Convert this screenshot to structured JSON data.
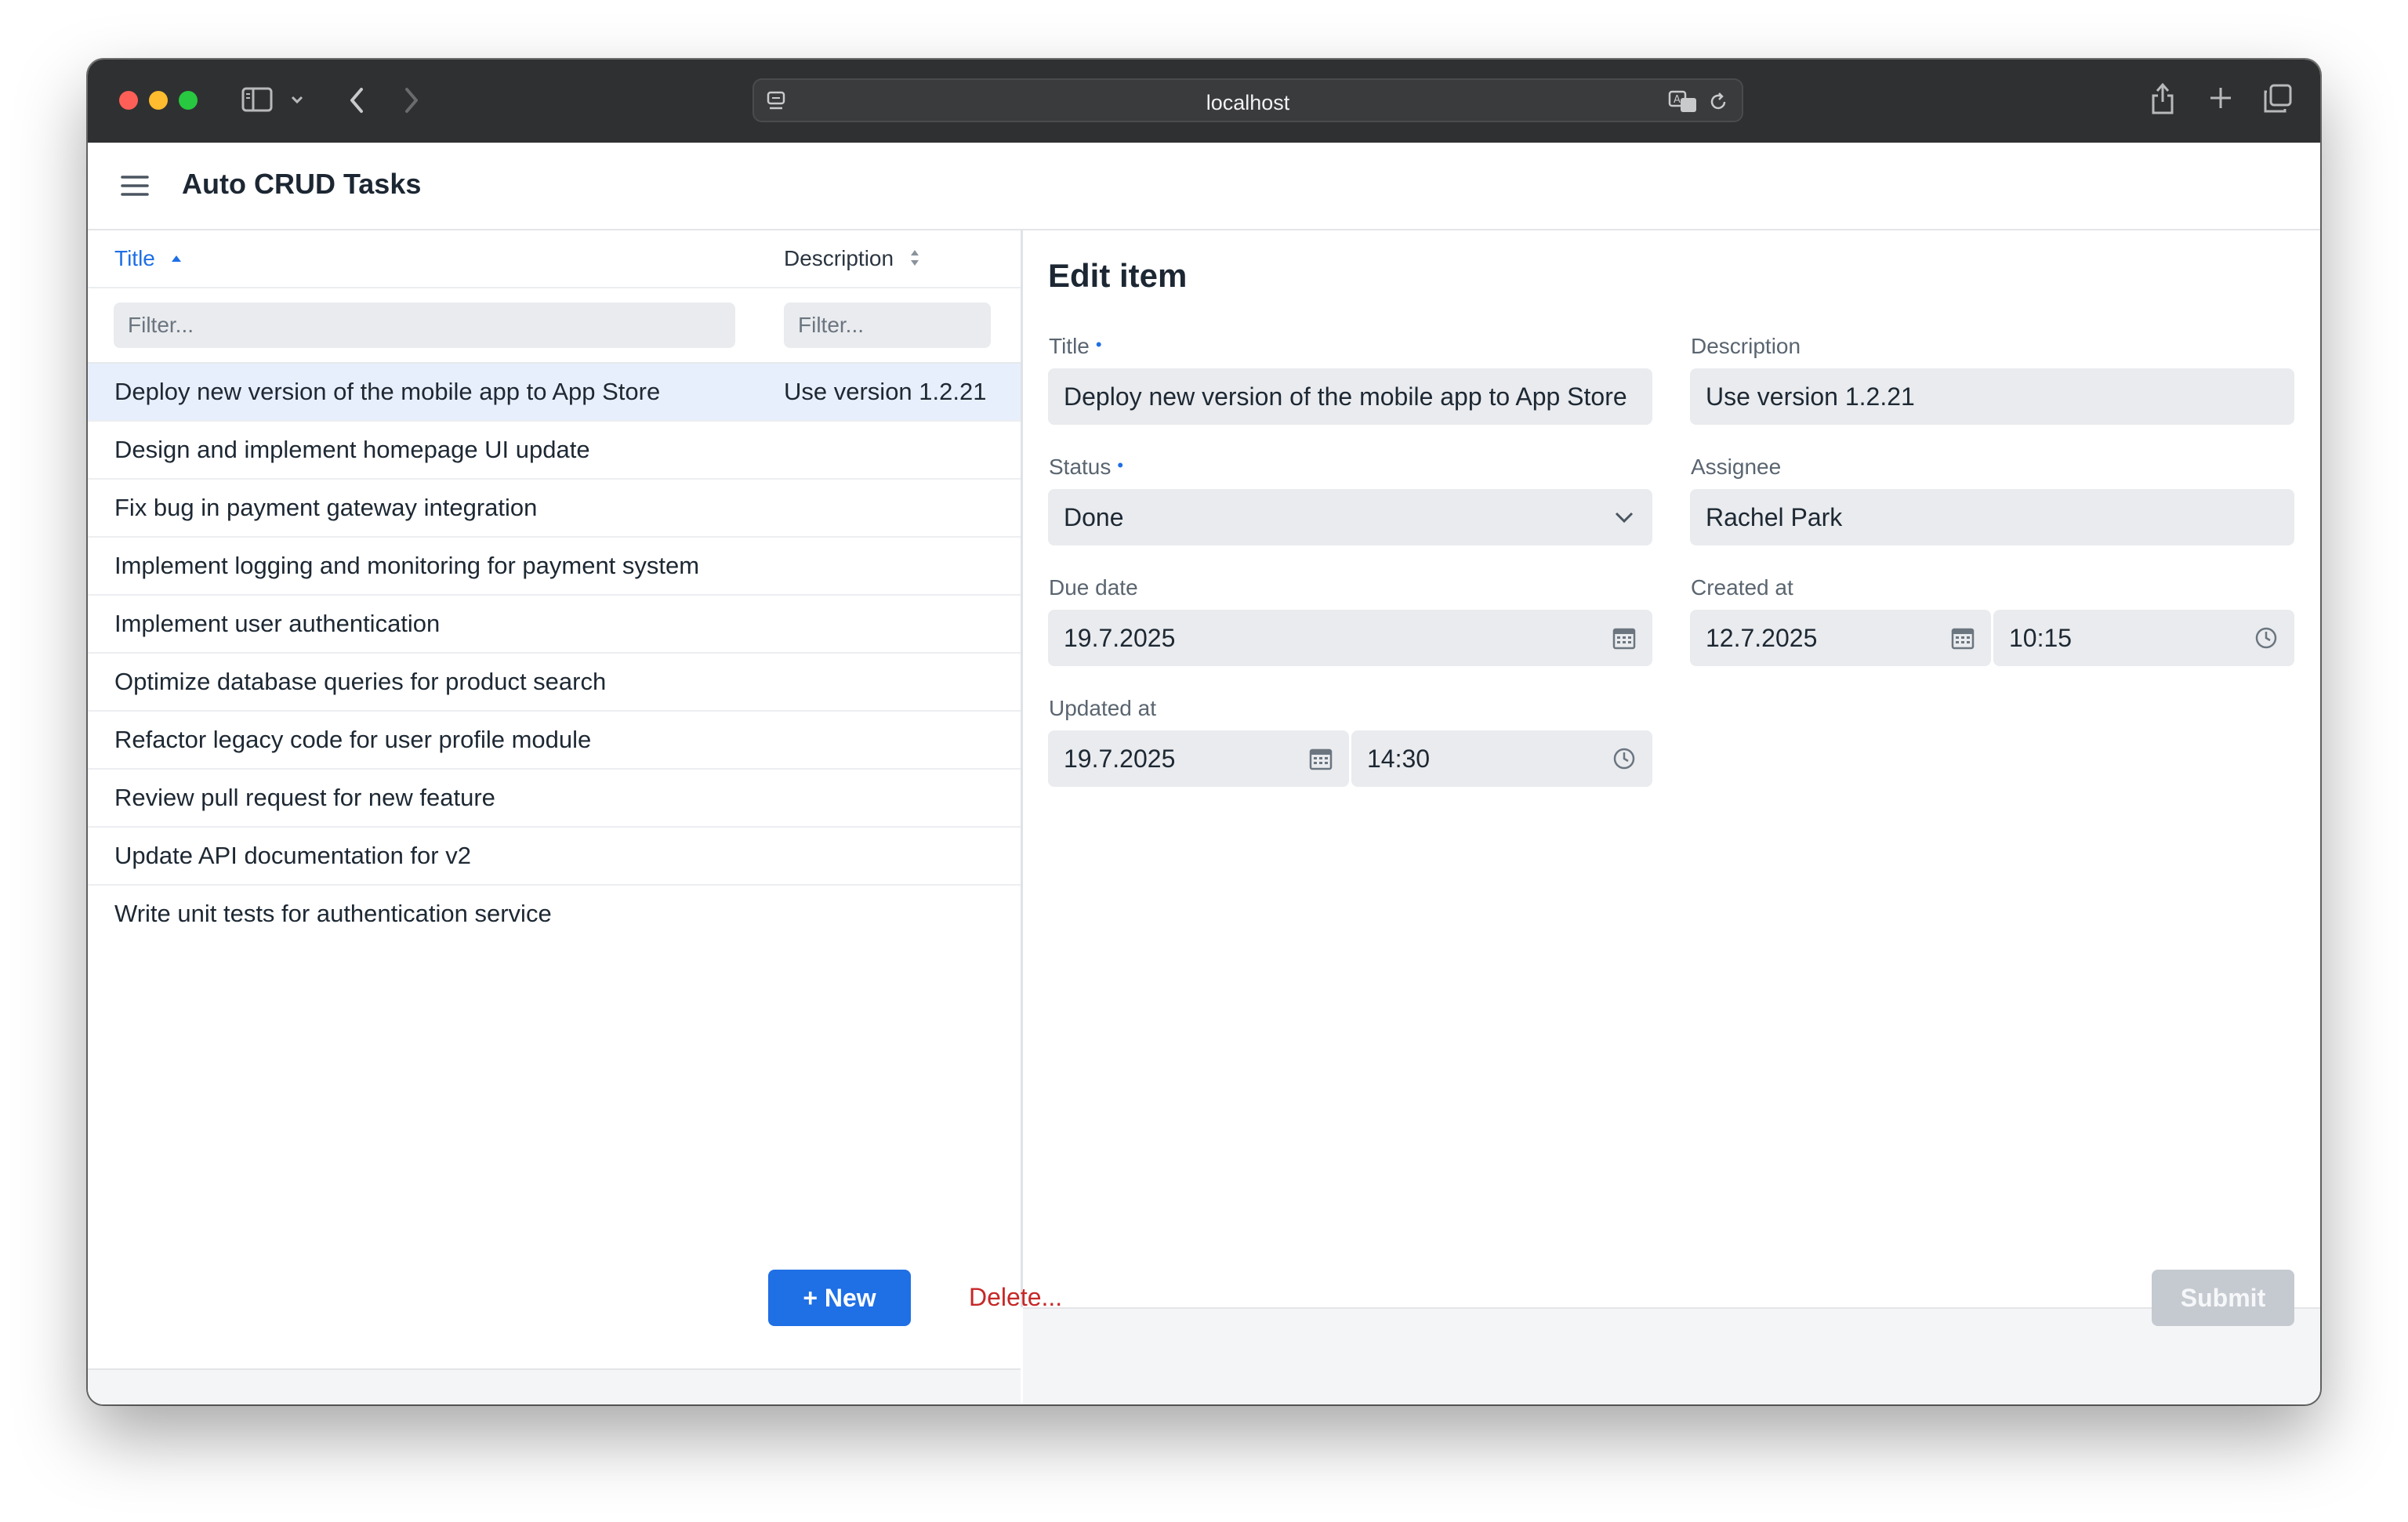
{
  "browser": {
    "url": "localhost",
    "traffic_lights": {
      "close": "#ff5f57",
      "minimize": "#febc2e",
      "zoom": "#28c840"
    }
  },
  "app": {
    "title": "Auto CRUD Tasks"
  },
  "grid": {
    "columns": [
      {
        "label": "Title",
        "sort": "ascending"
      },
      {
        "label": "Description",
        "sort": "none"
      }
    ],
    "filters": [
      {
        "placeholder": "Filter...",
        "value": ""
      },
      {
        "placeholder": "Filter...",
        "value": ""
      }
    ],
    "rows": [
      {
        "title": "Deploy new version of the mobile app to App Store",
        "description": "Use version 1.2.21",
        "selected": true
      },
      {
        "title": "Design and implement homepage UI update",
        "description": ""
      },
      {
        "title": "Fix bug in payment gateway integration",
        "description": ""
      },
      {
        "title": "Implement logging and monitoring for payment system",
        "description": ""
      },
      {
        "title": "Implement user authentication",
        "description": ""
      },
      {
        "title": "Optimize database queries for product search",
        "description": ""
      },
      {
        "title": "Refactor legacy code for user profile module",
        "description": ""
      },
      {
        "title": "Review pull request for new feature",
        "description": ""
      },
      {
        "title": "Update API documentation for v2",
        "description": ""
      },
      {
        "title": "Write unit tests for authentication service",
        "description": ""
      }
    ],
    "new_button": "+ New"
  },
  "form": {
    "title": "Edit item",
    "fields": {
      "title": {
        "label": "Title",
        "required": true,
        "value": "Deploy new version of the mobile app to App Store"
      },
      "description": {
        "label": "Description",
        "value": "Use version 1.2.21"
      },
      "status": {
        "label": "Status",
        "required": true,
        "value": "Done"
      },
      "assignee": {
        "label": "Assignee",
        "value": "Rachel Park"
      },
      "due_date": {
        "label": "Due date",
        "date": "19.7.2025"
      },
      "created_at": {
        "label": "Created at",
        "date": "12.7.2025",
        "time": "10:15"
      },
      "updated_at": {
        "label": "Updated at",
        "date": "19.7.2025",
        "time": "14:30"
      }
    },
    "delete_button": "Delete...",
    "submit_button": "Submit"
  },
  "colors": {
    "accent": "#1f6fe5",
    "danger": "#c62828",
    "selected_row": "#e8effc"
  }
}
